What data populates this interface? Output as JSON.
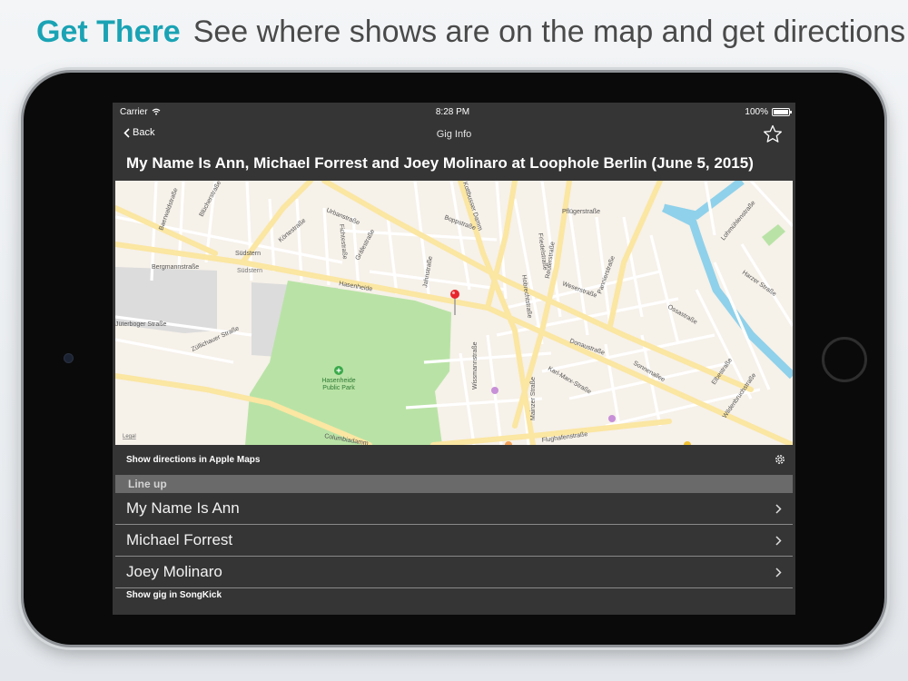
{
  "headline": {
    "accent": "Get There",
    "subtitle": "See where shows are on the map and get directions"
  },
  "status_bar": {
    "carrier": "Carrier",
    "time": "8:28 PM",
    "battery": "100%"
  },
  "nav": {
    "back_label": "Back",
    "title": "Gig Info"
  },
  "gig": {
    "title": "My Name Is Ann, Michael Forrest and Joey Molinaro at Loophole Berlin (June 5, 2015)"
  },
  "map": {
    "legal": "Legal",
    "park_name_line1": "Hasenheide",
    "park_name_line2": "Public Park",
    "streets": {
      "urbanstrasse": "Urbanstraße",
      "hasenheide": "Hasenheide",
      "sudstern": "Südstern",
      "sudstern2": "Südstern",
      "bergmannstrasse": "Bergmannstraße",
      "juterboger": "Jüterboger Straße",
      "zullichauer": "Züllichauer Straße",
      "columbiadamm": "Columbiadamm",
      "karl_marx": "Karl-Marx-Straße",
      "sonnenallee": "Sonnenallee",
      "flughafen": "Flughafenstraße",
      "hermannplatz": "Kottbusser Damm",
      "wissmann": "Wissmannstraße",
      "pannier": "Pannierstraße",
      "harzer": "Harzer Straße",
      "lohmuhlen": "Lohmühlenstraße",
      "wildenbruch": "Wildenbruchstraße",
      "mainzer": "Mainzer Straße",
      "jahn": "Jahnstraße",
      "boppstrasse": "Boppstraße",
      "kortestrasse": "Körtestraße",
      "blucher": "Blücherstraße",
      "baerwald": "Baerwaldstraße",
      "fichte": "Fichtestraße",
      "grafe": "Gräfestraße",
      "weser": "Weserstraße",
      "donau": "Donaustraße",
      "elbe": "Elbestraße",
      "ossastrasse": "Ossastraße",
      "pflueger": "Pflügerstraße",
      "reuter": "Reuterstraße",
      "hobrecht": "Hobrechtstraße",
      "friedel": "Friedelstraße"
    }
  },
  "actions": {
    "directions_label": "Show directions in Apple Maps",
    "songkick_label": "Show gig in SongKick"
  },
  "lineup": {
    "header": "Line up",
    "artists": [
      {
        "name": "My Name Is Ann"
      },
      {
        "name": "Michael Forrest"
      },
      {
        "name": "Joey Molinaro"
      }
    ]
  },
  "colors": {
    "accent": "#1aa3b4",
    "screen_bg": "#353535",
    "section_header": "#6a6a6a",
    "map_land": "#f6f1e9",
    "park": "#b9e3a6",
    "water": "#8fd1ea",
    "pin": "#e8262b"
  }
}
